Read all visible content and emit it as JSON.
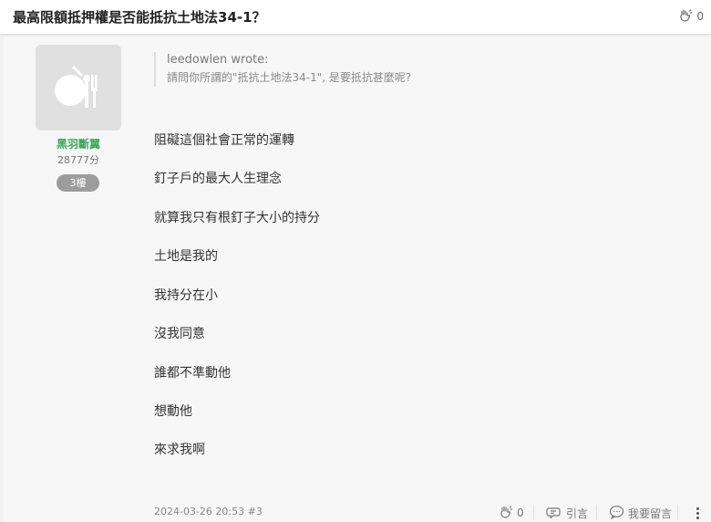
{
  "topic": {
    "title": "最高限額抵押權是否能抵抗土地法34-1？",
    "clap_count": "0"
  },
  "post": {
    "author": {
      "name": "黑羽斷翼",
      "points": "28777分",
      "floor_badge": "3樓"
    },
    "quote": {
      "author": "leedowlen wrote:",
      "text": "請問你所謂的\"抵抗土地法34-1\", 是要抵抗甚麼呢?"
    },
    "lines": [
      "阻礙這個社會正常的運轉",
      "釘子戶的最大人生理念",
      "就算我只有根釘子大小的持分",
      "土地是我的",
      "我持分在小",
      "沒我同意",
      "誰都不準動他",
      "想動他",
      "來求我啊"
    ],
    "meta": "2024-03-26 20:53 #3",
    "actions": {
      "clap_count": "0",
      "quote_label": "引言",
      "reply_label": "我要留言"
    }
  },
  "colors": {
    "author_name": "#3aa55c",
    "badge": "#9c9c9c",
    "avatar_bg": "#e0e0e0"
  }
}
